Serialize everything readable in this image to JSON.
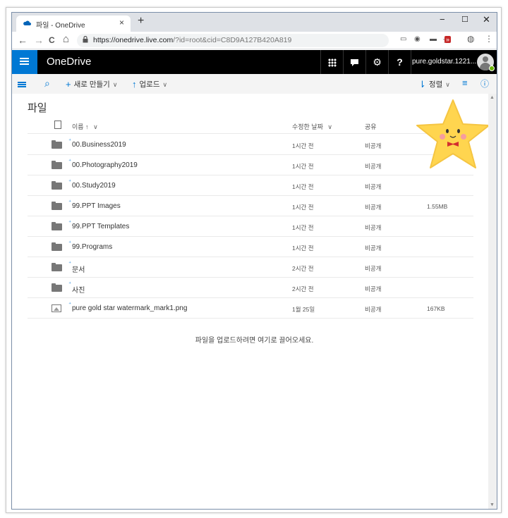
{
  "browser": {
    "tab_title": "파일 - OneDrive",
    "tab_close": "×",
    "new_tab": "+",
    "minimize": "−",
    "maximize": "☐",
    "close": "✕",
    "back": "←",
    "forward": "→",
    "reload": "C",
    "home": "⌂",
    "lock": "🔒",
    "url_host": "https://onedrive.live.com",
    "url_path": "/?id=root&cid=C8D9A127B420A819",
    "star": "☆",
    "ext_menu": "⋮"
  },
  "header": {
    "brand": "OneDrive",
    "user_name": "pure.goldstar.1221...",
    "help": "?",
    "settings": "⚙",
    "chat": "💬"
  },
  "command_bar": {
    "search_icon": "⌕",
    "new_label": "새로 만들기",
    "upload_label": "업로드",
    "sort_label": "정렬",
    "chev": "∨",
    "plus": "+",
    "upload_arrow": "↑",
    "sort_icon": "⇂",
    "view_icon": "≡",
    "info_icon": "ⓘ"
  },
  "page": {
    "title": "파일",
    "drop_hint": "파일을 업로드하려면 여기로 끌어오세요."
  },
  "columns": {
    "name": "이름 ↑",
    "modified": "수정한 날짜",
    "sharing": "공유",
    "chev": "∨"
  },
  "files": [
    {
      "name": "00.Business2019",
      "modified": "1시간 전",
      "sharing": "비공개",
      "size": "",
      "type": "folder"
    },
    {
      "name": "00.Photography2019",
      "modified": "1시간 전",
      "sharing": "비공개",
      "size": "",
      "type": "folder"
    },
    {
      "name": "00.Study2019",
      "modified": "1시간 전",
      "sharing": "비공개",
      "size": "",
      "type": "folder"
    },
    {
      "name": "99.PPT Images",
      "modified": "1시간 전",
      "sharing": "비공개",
      "size": "1.55MB",
      "type": "folder"
    },
    {
      "name": "99.PPT Templates",
      "modified": "1시간 전",
      "sharing": "비공개",
      "size": "",
      "type": "folder"
    },
    {
      "name": "99.Programs",
      "modified": "1시간 전",
      "sharing": "비공개",
      "size": "",
      "type": "folder"
    },
    {
      "name": "문서",
      "modified": "2시간 전",
      "sharing": "비공개",
      "size": "",
      "type": "folder"
    },
    {
      "name": "사진",
      "modified": "2시간 전",
      "sharing": "비공개",
      "size": "",
      "type": "folder"
    },
    {
      "name": "pure gold star watermark_mark1.png",
      "modified": "1월 25일",
      "sharing": "비공개",
      "size": "167KB",
      "type": "image"
    }
  ],
  "sync_mark": "⁺",
  "colors": {
    "accent": "#0078d4",
    "header_bg": "#000000",
    "watermark_star": "#ffd54f"
  }
}
